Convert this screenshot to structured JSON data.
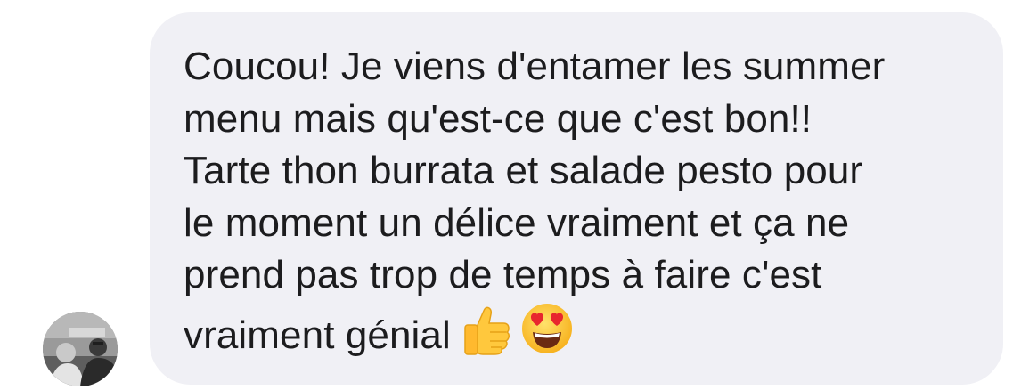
{
  "message": {
    "lines": [
      "Coucou! Je viens d'entamer les summer",
      "menu mais qu'est-ce que c'est bon!!",
      "Tarte thon burrata et salade pesto pour",
      "le moment un délice vraiment et ça ne",
      "prend pas trop de temps à faire c'est",
      "vraiment génial"
    ],
    "emojis": [
      "thumbs-up-icon",
      "heart-eyes-icon"
    ]
  },
  "colors": {
    "bubble_background": "#f0f0f5",
    "text": "#1c1c1e",
    "emoji_yellow": "#ffc83d",
    "emoji_heart": "#e8262e"
  }
}
